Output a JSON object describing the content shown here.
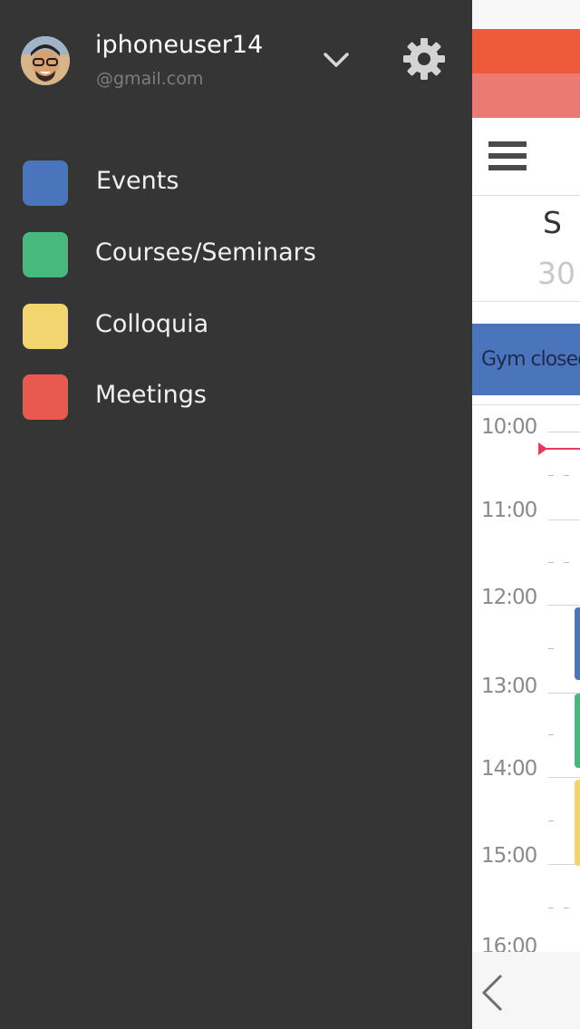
{
  "drawer": {
    "user": {
      "name": "iphoneuser14",
      "email": "@gmail.com"
    },
    "icons": {
      "account_switch": "chevron-down-icon",
      "settings": "gear-icon"
    },
    "categories": [
      {
        "label": "Events",
        "color": "#4a74bb"
      },
      {
        "label": "Courses/Seminars",
        "color": "#47b97c"
      },
      {
        "label": "Colloquia",
        "color": "#f3d56f"
      },
      {
        "label": "Meetings",
        "color": "#e85a4f"
      }
    ]
  },
  "calendar": {
    "day_letter": "S",
    "day_number": "30",
    "all_day_event": "Gym closed",
    "hours": [
      "10:00",
      "11:00",
      "12:00",
      "13:00",
      "14:00",
      "15:00",
      "16:00"
    ],
    "colors": {
      "header_red": "#ed5a3c",
      "header_pink": "#ec7a74",
      "now_indicator": "#e23b5f",
      "events_blue": "#4a74bb",
      "courses_green": "#47b97c",
      "colloquia_yellow": "#f3d56f"
    }
  }
}
